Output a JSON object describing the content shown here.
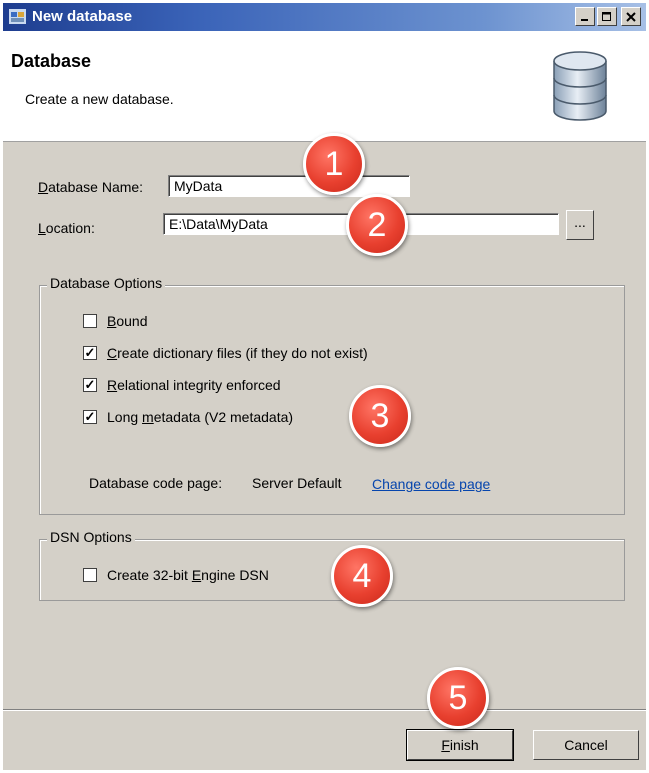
{
  "window": {
    "title": "New database",
    "controls": {
      "minimize": "_",
      "maximize": "□",
      "close": "X"
    }
  },
  "header": {
    "title": "Database",
    "subtitle": "Create a new database.",
    "icon": "database-icon"
  },
  "form": {
    "name_label_prefix": "D",
    "name_label_rest": "atabase Name:",
    "name_value": "MyData",
    "location_label_prefix": "L",
    "location_label_rest": "ocation:",
    "location_value": "E:\\Data\\MyData",
    "browse_label": "..."
  },
  "db_options": {
    "title": "Database Options",
    "items": [
      {
        "u": "B",
        "rest": "ound",
        "pre": "",
        "checked": false
      },
      {
        "u": "C",
        "rest": "reate dictionary files (if they do not exist)",
        "pre": "",
        "checked": true
      },
      {
        "u": "R",
        "rest": "elational integrity enforced",
        "pre": "",
        "checked": true
      },
      {
        "u": "m",
        "rest": "etadata (V2 metadata)",
        "pre": "Long ",
        "checked": true
      }
    ],
    "code_page_label": "Database code page:",
    "code_page_value": "Server Default",
    "change_link": "Change code page"
  },
  "dsn_options": {
    "title": "DSN Options",
    "item_pre": "Create 32-bit ",
    "item_u": "E",
    "item_rest": "ngine DSN",
    "checked": false
  },
  "buttons": {
    "finish_u": "F",
    "finish_rest": "inish",
    "cancel": "Cancel"
  },
  "callouts": [
    "1",
    "2",
    "3",
    "4",
    "5"
  ],
  "colors": {
    "callout": "#e8402f",
    "titlebar": "#1e3d8f",
    "link": "#0645ad",
    "face": "#d4d0c8"
  }
}
